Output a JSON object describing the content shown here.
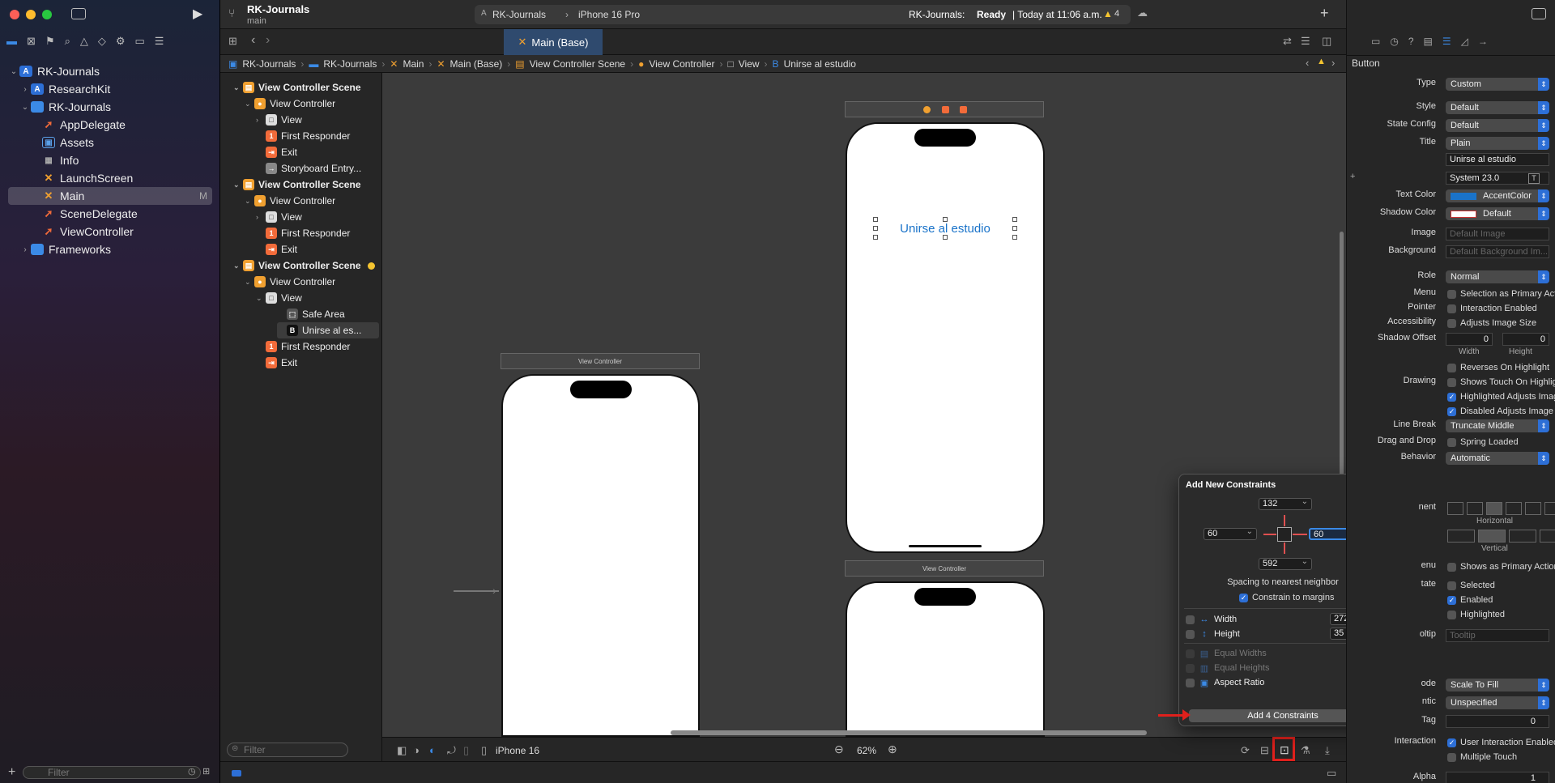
{
  "window": {
    "project": "RK-Journals",
    "branch": "main"
  },
  "toolbar": {
    "scheme": "RK-Journals",
    "device": "iPhone 16 Pro",
    "status_prefix": "RK-Journals:",
    "status_state": "Ready",
    "status_time": "| Today at 11:06 a.m.",
    "warnings": "4"
  },
  "tab": {
    "label": "Main (Base)"
  },
  "jumpbar": [
    "RK-Journals",
    "RK-Journals",
    "Main",
    "Main (Base)",
    "View Controller Scene",
    "View Controller",
    "View",
    "Unirse al estudio"
  ],
  "navigator": {
    "items": [
      {
        "label": "RK-Journals",
        "badge": ""
      },
      {
        "label": "ResearchKit",
        "badge": ""
      },
      {
        "label": "RK-Journals",
        "badge": ""
      },
      {
        "label": "AppDelegate",
        "badge": ""
      },
      {
        "label": "Assets",
        "badge": ""
      },
      {
        "label": "Info",
        "badge": ""
      },
      {
        "label": "LaunchScreen",
        "badge": ""
      },
      {
        "label": "Main",
        "badge": "M"
      },
      {
        "label": "SceneDelegate",
        "badge": ""
      },
      {
        "label": "ViewController",
        "badge": ""
      },
      {
        "label": "Frameworks",
        "badge": ""
      }
    ],
    "filter_placeholder": "Filter"
  },
  "outline": {
    "rows": [
      "View Controller Scene",
      "View Controller",
      "View",
      "First Responder",
      "Exit",
      "Storyboard Entry...",
      "View Controller Scene",
      "View Controller",
      "View",
      "First Responder",
      "Exit",
      "View Controller Scene",
      "View Controller",
      "View",
      "Safe Area",
      "Unirse al es...",
      "First Responder",
      "Exit"
    ],
    "filter_placeholder": "Filter"
  },
  "canvas": {
    "scene_label_1": "View Controller",
    "scene_label_2": "View Controller",
    "button_title": "Unirse al estudio",
    "device": "iPhone 16",
    "zoom": "62%"
  },
  "popover": {
    "title": "Add New Constraints",
    "top": "132",
    "left": "60",
    "right": "60",
    "bottom": "592",
    "spacing_label": "Spacing to nearest neighbor",
    "constrain_margins": "Constrain to margins",
    "width_label": "Width",
    "width_value": "272",
    "height_label": "Height",
    "height_value": "35",
    "equal_widths": "Equal Widths",
    "equal_heights": "Equal Heights",
    "aspect_ratio": "Aspect Ratio",
    "add_button": "Add 4 Constraints"
  },
  "inspector": {
    "section": "Button",
    "type_label": "Type",
    "type_value": "Custom",
    "style_label": "Style",
    "style_value": "Default",
    "state_label": "State Config",
    "state_value": "Default",
    "title_label": "Title",
    "title_value": "Plain",
    "title_text": "Unirse al estudio",
    "font_value": "System 23.0",
    "textcolor_label": "Text Color",
    "textcolor_value": "AccentColor",
    "shadowcolor_label": "Shadow Color",
    "shadowcolor_value": "Default",
    "image_label": "Image",
    "image_placeholder": "Default Image",
    "background_label": "Background",
    "background_placeholder": "Default Background Im...",
    "role_label": "Role",
    "role_value": "Normal",
    "menu_label": "Menu",
    "menu_value": "Selection as Primary Acti...",
    "pointer_label": "Pointer",
    "pointer_value": "Interaction Enabled",
    "access_label": "Accessibility",
    "access_value": "Adjusts Image Size",
    "shadowoffset_label": "Shadow Offset",
    "shadow_w": "0",
    "shadow_h": "0",
    "width_sub": "Width",
    "height_sub": "Height",
    "reverses": "Reverses On Highlight",
    "drawing_label": "Drawing",
    "drawing_value": "Shows Touch On Highlight",
    "highlighted_adj": "Highlighted Adjusts Image",
    "disabled_adj": "Disabled Adjusts Image",
    "linebreak_label": "Line Break",
    "linebreak_value": "Truncate Middle",
    "dragdrop_label": "Drag and Drop",
    "dragdrop_value": "Spring Loaded",
    "behavior_label": "Behavior",
    "behavior_value": "Automatic",
    "alignment_label": "nent",
    "horizontal_label": "Horizontal",
    "vertical_label": "Vertical",
    "menu2_label": "enu",
    "menu2_value": "Shows as Primary Action",
    "state2_label": "tate",
    "selected": "Selected",
    "enabled": "Enabled",
    "highlighted": "Highlighted",
    "tooltip_label": "oltip",
    "tooltip_placeholder": "Tooltip",
    "mode_label": "ode",
    "mode_value": "Scale To Fill",
    "semantic_label": "ntic",
    "semantic_value": "Unspecified",
    "tag_label": "Tag",
    "tag_value": "0",
    "interaction_label": "Interaction",
    "user_interaction": "User Interaction Enabled",
    "multiple_touch": "Multiple Touch",
    "alpha_label": "Alpha",
    "alpha_value": "1"
  },
  "colors": {
    "accent": "#2d6fd6",
    "highlight_red": "#e0201c",
    "button_text": "#1a73c9"
  }
}
